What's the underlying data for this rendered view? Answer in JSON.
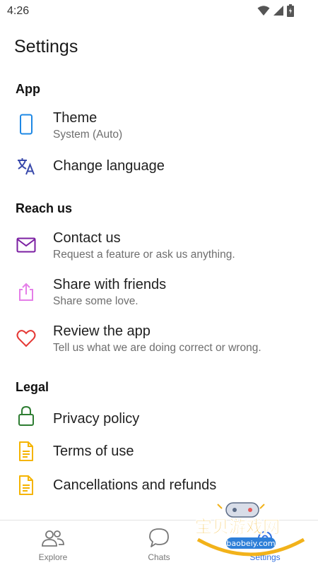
{
  "status_bar": {
    "time": "4:26"
  },
  "page": {
    "title": "Settings"
  },
  "sections": {
    "app": {
      "title": "App",
      "theme": {
        "title": "Theme",
        "subtitle": "System (Auto)",
        "icon": "phone-icon"
      },
      "language": {
        "title": "Change language",
        "icon": "translate-icon"
      }
    },
    "reach": {
      "title": "Reach us",
      "contact": {
        "title": "Contact us",
        "subtitle": "Request a feature or ask us anything.",
        "icon": "mail-icon"
      },
      "share": {
        "title": "Share with friends",
        "subtitle": "Share some love.",
        "icon": "share-icon"
      },
      "review": {
        "title": "Review the app",
        "subtitle": "Tell us what we are doing correct or wrong.",
        "icon": "heart-icon"
      }
    },
    "legal": {
      "title": "Legal",
      "privacy": {
        "title": "Privacy policy",
        "icon": "lock-icon"
      },
      "terms": {
        "title": "Terms of use",
        "icon": "document-icon"
      },
      "refunds": {
        "title": "Cancellations and refunds",
        "icon": "document-icon"
      }
    }
  },
  "bottom_nav": {
    "explore": "Explore",
    "chats": "Chats",
    "settings": "Settings"
  },
  "watermark": {
    "cn_text": "宝贝游戏网",
    "url_text": "baobeiy.com"
  },
  "colors": {
    "blue": "#1e88e5",
    "indigo": "#3949ab",
    "purple": "#7b1fa2",
    "pink": "#e57ee8",
    "red": "#e53935",
    "green": "#2e7d32",
    "amber": "#f5b400",
    "active": "#2f6fe0"
  }
}
